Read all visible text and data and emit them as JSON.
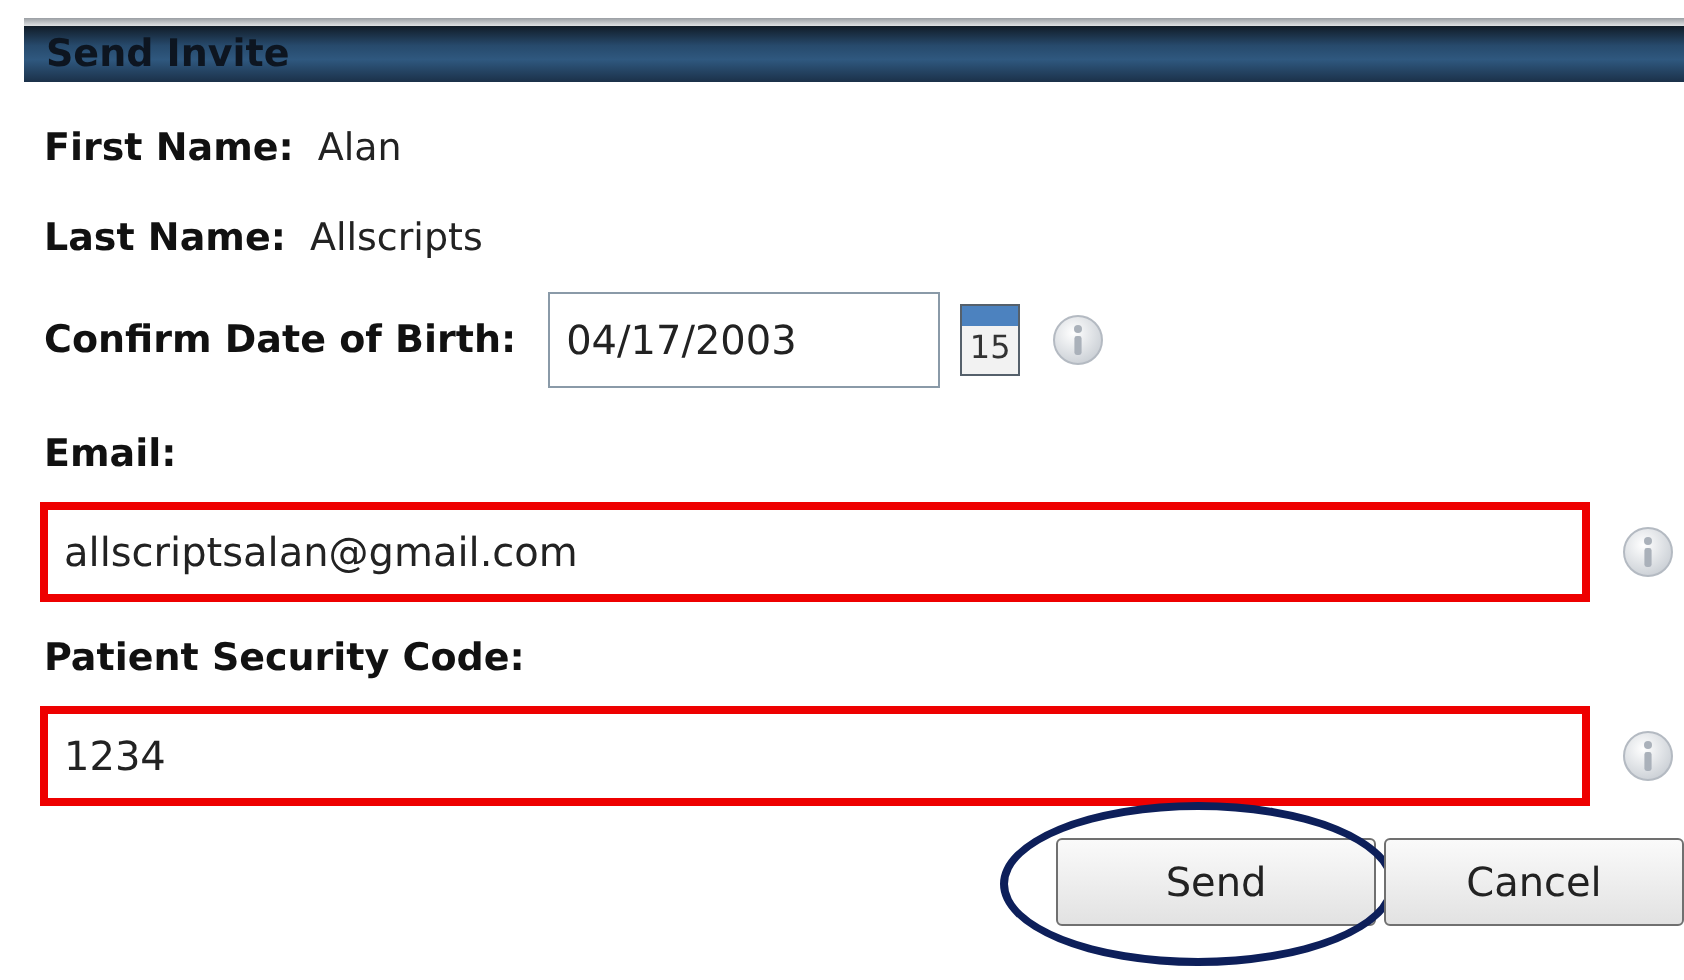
{
  "title": "Send Invite",
  "info": [
    {
      "label": "First Name:",
      "value": "Alan"
    },
    {
      "label": "Last Name:",
      "value": "Allscripts"
    }
  ],
  "dob": {
    "label": "Confirm Date of Birth:",
    "value": "04/17/2003",
    "calendar_day": "15"
  },
  "fields": [
    {
      "label": "Email:",
      "value": "allscriptsalan@gmail.com",
      "highlighted": true
    },
    {
      "label": "Patient Security Code:",
      "value": "1234",
      "highlighted": true
    }
  ],
  "buttons": [
    {
      "label": "Send",
      "circled": true
    },
    {
      "label": "Cancel",
      "circled": false
    }
  ]
}
